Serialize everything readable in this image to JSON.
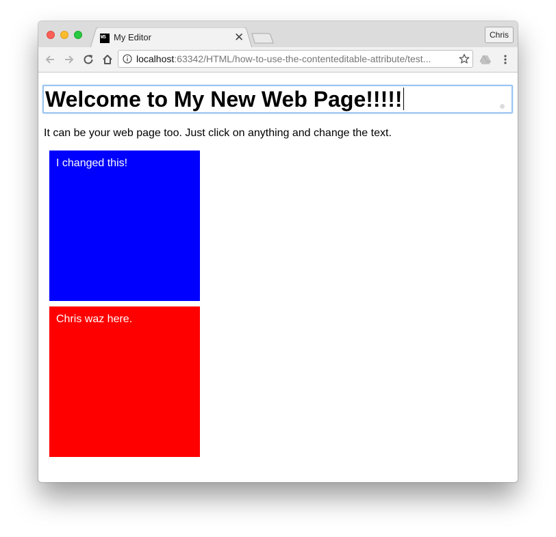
{
  "window": {
    "tab_title": "My Editor",
    "tab_favicon_text": "WS",
    "profile_label": "Chris"
  },
  "address_bar": {
    "host": "localhost",
    "rest": ":63342/HTML/how-to-use-the-contenteditable-attribute/test..."
  },
  "page": {
    "heading": "Welcome to My New Web Page!!!!!",
    "paragraph": "It can be your web page too. Just click on anything and change the text.",
    "boxes": [
      {
        "text": "I changed this!",
        "color": "#0000ff"
      },
      {
        "text": "Chris waz here.",
        "color": "#ff0000"
      }
    ]
  },
  "icons": {
    "back": "back-arrow-icon",
    "forward": "forward-arrow-icon",
    "reload": "reload-icon",
    "home": "home-icon",
    "info": "info-icon",
    "bookmark": "star-icon",
    "drive": "drive-icon",
    "menu": "kebab-menu-icon",
    "close_tab": "close-icon"
  },
  "colors": {
    "focus_outline": "#9ac4f0",
    "titlebar": "#dcdcdc",
    "toolbar": "#f2f2f2"
  }
}
